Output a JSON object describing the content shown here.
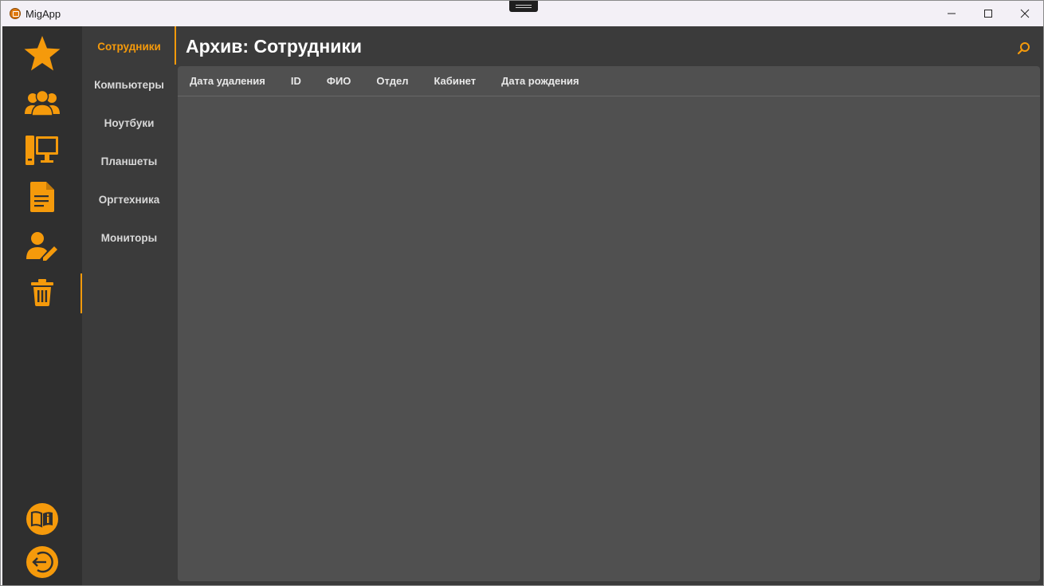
{
  "window": {
    "title": "MigApp",
    "controls": [
      "minimize-icon",
      "maximize-icon",
      "close-icon"
    ]
  },
  "colors": {
    "accent": "#f59a0b",
    "rail_bg": "#2f2f2f",
    "nav_bg": "#3b3b3b",
    "panel_bg": "#505050",
    "text": "#d8d8d8"
  },
  "icon_rail": {
    "items": [
      {
        "icon": "star-icon"
      },
      {
        "icon": "users-icon"
      },
      {
        "icon": "computer-icon"
      },
      {
        "icon": "document-icon"
      },
      {
        "icon": "user-edit-icon"
      },
      {
        "icon": "trash-icon",
        "active": true
      }
    ],
    "bottom_items": [
      {
        "icon": "book-info-icon"
      },
      {
        "icon": "logout-icon"
      }
    ]
  },
  "nav": {
    "items": [
      {
        "label": "Сотрудники",
        "active": true
      },
      {
        "label": "Компьютеры"
      },
      {
        "label": "Ноутбуки"
      },
      {
        "label": "Планшеты"
      },
      {
        "label": "Оргтехника"
      },
      {
        "label": "Мониторы"
      }
    ]
  },
  "main": {
    "title": "Архив: Сотрудники",
    "search_icon": "search-icon",
    "columns": [
      "Дата удаления",
      "ID",
      "ФИО",
      "Отдел",
      "Кабинет",
      "Дата рождения"
    ],
    "rows": []
  }
}
